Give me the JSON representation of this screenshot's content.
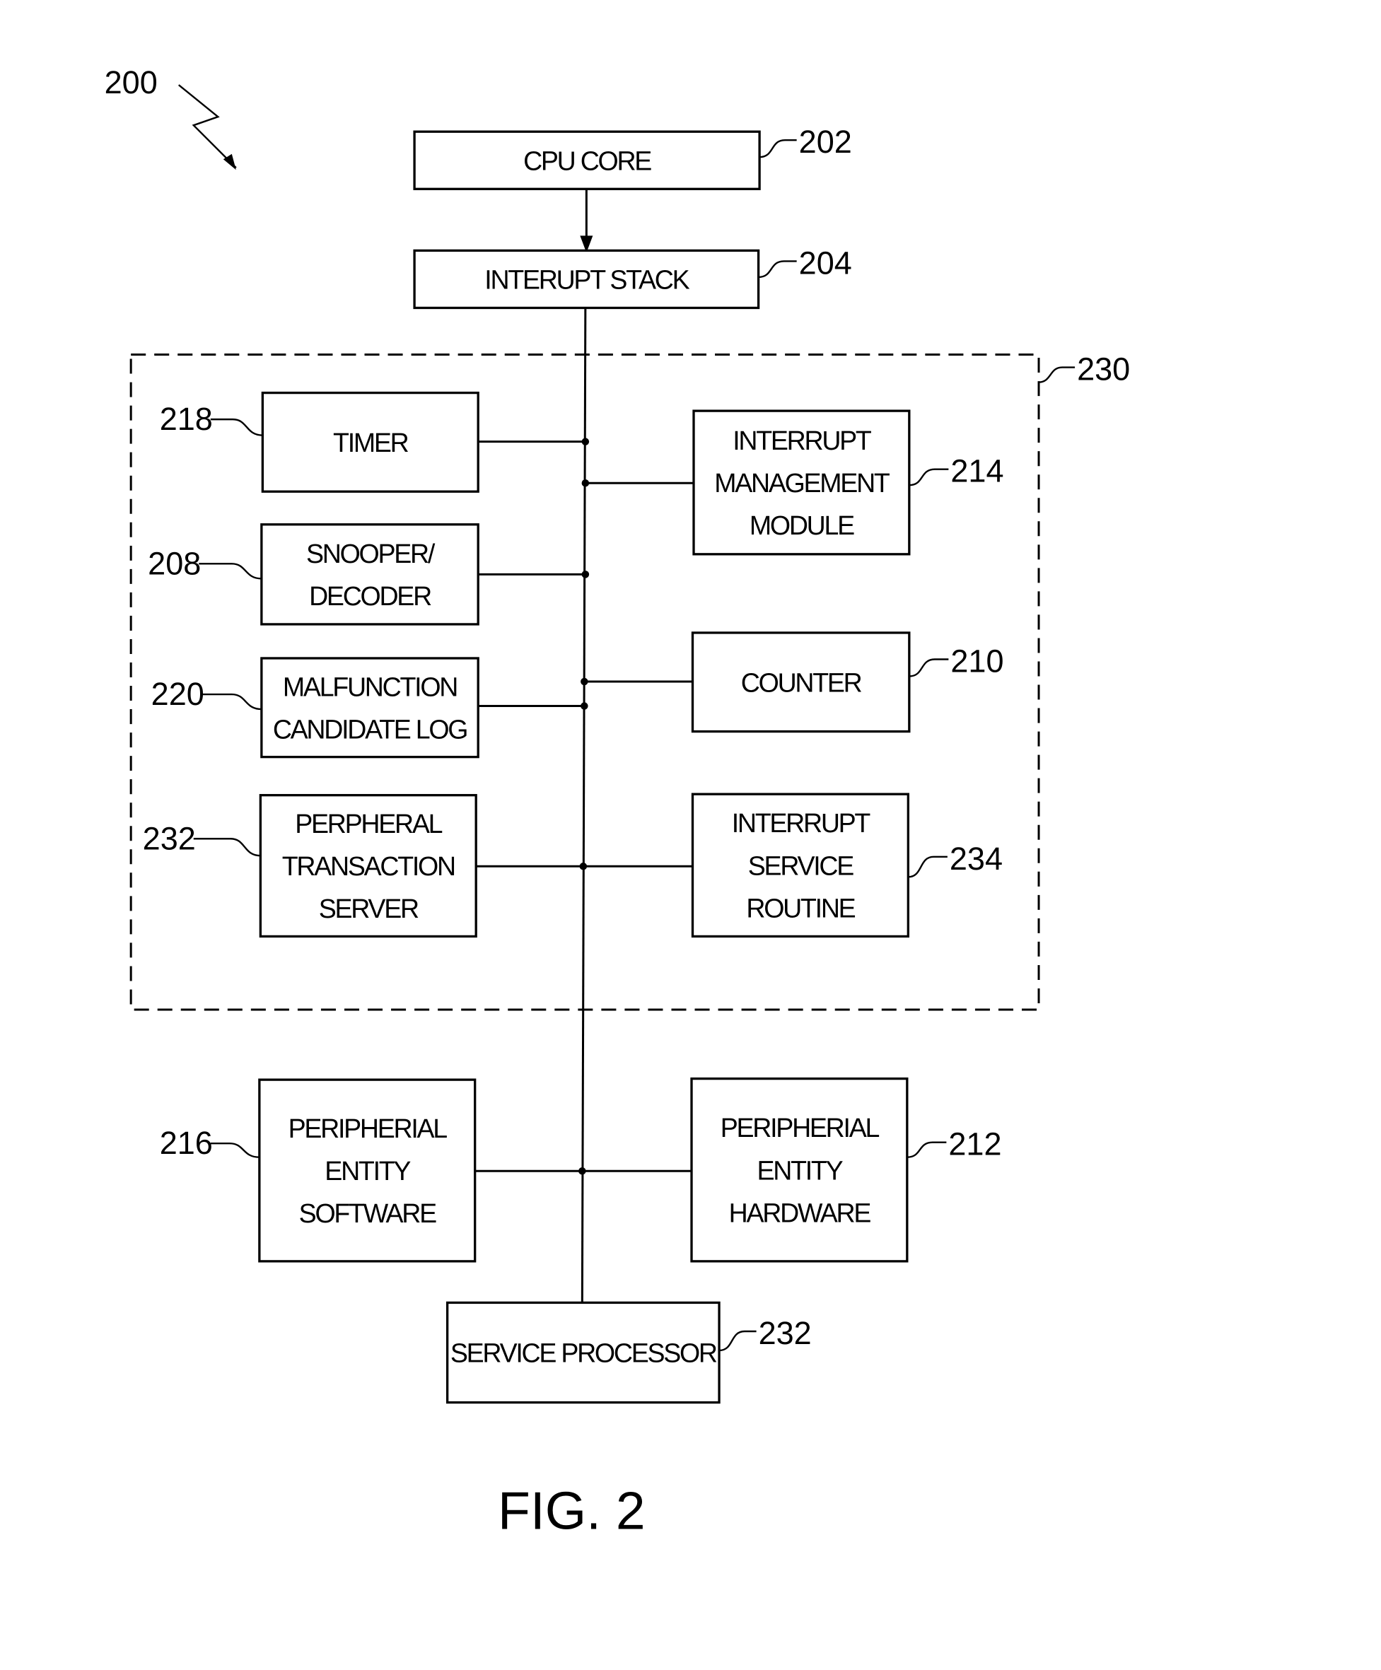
{
  "figure": {
    "label": "FIG. 2",
    "ref": "200",
    "group_ref": "230"
  },
  "blocks": [
    {
      "id": "cpu-core",
      "ref": "202",
      "lines": [
        "CPU CORE"
      ]
    },
    {
      "id": "interrupt-stack",
      "ref": "204",
      "lines": [
        "INTERUPT STACK"
      ]
    },
    {
      "id": "timer",
      "ref": "218",
      "lines": [
        "TIMER"
      ]
    },
    {
      "id": "interrupt-management-module",
      "ref": "214",
      "lines": [
        "INTERRUPT",
        "MANAGEMENT",
        "MODULE"
      ]
    },
    {
      "id": "snooper-decoder",
      "ref": "208",
      "lines": [
        "SNOOPER/",
        "DECODER"
      ]
    },
    {
      "id": "counter",
      "ref": "210",
      "lines": [
        "COUNTER"
      ]
    },
    {
      "id": "malfunction-candidate-log",
      "ref": "220",
      "lines": [
        "MALFUNCTION",
        "CANDIDATE LOG"
      ]
    },
    {
      "id": "peripheral-transaction-server",
      "ref": "232",
      "lines": [
        "PERPHERAL",
        "TRANSACTION",
        "SERVER"
      ]
    },
    {
      "id": "interrupt-service-routine",
      "ref": "234",
      "lines": [
        "INTERRUPT",
        "SERVICE",
        "ROUTINE"
      ]
    },
    {
      "id": "peripheral-entity-software",
      "ref": "216",
      "lines": [
        "PERIPHERIAL",
        "ENTITY",
        "SOFTWARE"
      ]
    },
    {
      "id": "peripheral-entity-hardware",
      "ref": "212",
      "lines": [
        "PERIPHERIAL",
        "ENTITY",
        "HARDWARE"
      ]
    },
    {
      "id": "service-processor",
      "ref": "232",
      "lines": [
        "SERVICE PROCESSOR"
      ]
    }
  ],
  "connections": [
    {
      "from": "cpu-core",
      "to": "interrupt-stack",
      "type": "arrow"
    },
    {
      "from": "interrupt-stack",
      "to": "bus",
      "type": "line"
    },
    {
      "from": "timer",
      "to": "bus",
      "type": "line"
    },
    {
      "from": "interrupt-management-module",
      "to": "bus",
      "type": "line"
    },
    {
      "from": "snooper-decoder",
      "to": "bus",
      "type": "line"
    },
    {
      "from": "counter",
      "to": "bus",
      "type": "line"
    },
    {
      "from": "malfunction-candidate-log",
      "to": "bus",
      "type": "line"
    },
    {
      "from": "peripheral-transaction-server",
      "to": "bus",
      "type": "line"
    },
    {
      "from": "interrupt-service-routine",
      "to": "bus",
      "type": "line"
    },
    {
      "from": "peripheral-entity-software",
      "to": "bus",
      "type": "line"
    },
    {
      "from": "peripheral-entity-hardware",
      "to": "bus",
      "type": "line"
    },
    {
      "from": "bus",
      "to": "service-processor",
      "type": "line"
    }
  ]
}
